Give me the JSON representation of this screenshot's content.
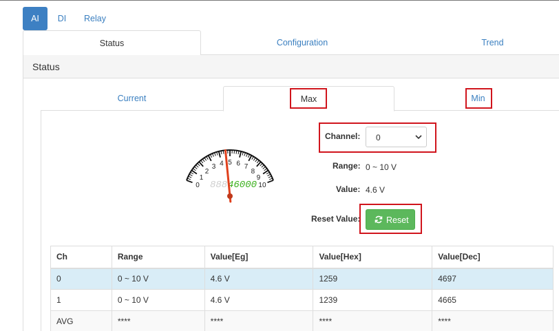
{
  "top_tabs": [
    "AI",
    "DI",
    "Relay"
  ],
  "main_tabs": [
    "Status",
    "Configuration",
    "Trend"
  ],
  "panel": {
    "title": "Status"
  },
  "sub_tabs": [
    "Current",
    "Max",
    "Min"
  ],
  "gauge": {
    "scale_labels": [
      "0",
      "1",
      "2",
      "3",
      "4",
      "5",
      "6",
      "7",
      "8",
      "9",
      "10"
    ],
    "digits_ghost": "888",
    "digits_lit": "46000",
    "needle_value": 4.6,
    "scale_max": 10
  },
  "form": {
    "channel_label": "Channel:",
    "channel_value": "0",
    "range_label": "Range:",
    "range_value": "0 ~ 10 V",
    "value_label": "Value:",
    "value_value": "4.6 V",
    "reset_label": "Reset Value:",
    "reset_button": "Reset"
  },
  "table": {
    "headers": [
      "Ch",
      "Range",
      "Value[Eg]",
      "Value[Hex]",
      "Value[Dec]"
    ],
    "rows": [
      [
        "0",
        "0 ~ 10 V",
        "4.6 V",
        "1259",
        "4697"
      ],
      [
        "1",
        "0 ~ 10 V",
        "4.6 V",
        "1239",
        "4665"
      ],
      [
        "AVG",
        "****",
        "****",
        "****",
        "****"
      ]
    ]
  },
  "colors": {
    "primary": "#3d80c3",
    "link": "#3a7fc0",
    "success": "#5cb85c",
    "highlight_row": "#d9edf7",
    "annotation_red": "#d0141c",
    "needle": "#e0401c",
    "lcd_green": "#3cb01e"
  }
}
